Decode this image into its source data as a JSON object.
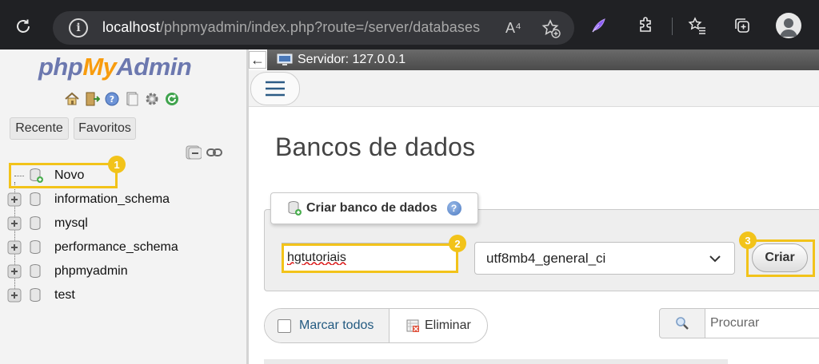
{
  "browser": {
    "url_host": "localhost",
    "url_path": "/phpmyadmin/index.php?route=/server/databases",
    "read_aloud_glyph": "A⁴"
  },
  "sidebar": {
    "logo": {
      "php": "php",
      "my": "My",
      "admin": "Admin"
    },
    "tabs": [
      "Recente",
      "Favoritos"
    ],
    "tree": [
      {
        "label": "Novo",
        "kind": "new"
      },
      {
        "label": "information_schema",
        "kind": "db"
      },
      {
        "label": "mysql",
        "kind": "db"
      },
      {
        "label": "performance_schema",
        "kind": "db"
      },
      {
        "label": "phpmyadmin",
        "kind": "db"
      },
      {
        "label": "test",
        "kind": "db"
      }
    ]
  },
  "topbar": {
    "server_label": "Servidor: 127.0.0.1"
  },
  "main": {
    "title": "Bancos de dados",
    "create": {
      "legend": "Criar banco de dados",
      "db_name_value": "hgtutoriais",
      "collation": "utf8mb4_general_ci",
      "submit_label": "Criar"
    },
    "actions": {
      "check_all": "Marcar todos",
      "drop": "Eliminar"
    },
    "search": {
      "placeholder": "Procurar"
    }
  },
  "annotations": [
    "1",
    "2",
    "3"
  ],
  "colors": {
    "annotation": "#f2c31a",
    "browser_bg": "#202124",
    "link_blue": "#235a81"
  }
}
